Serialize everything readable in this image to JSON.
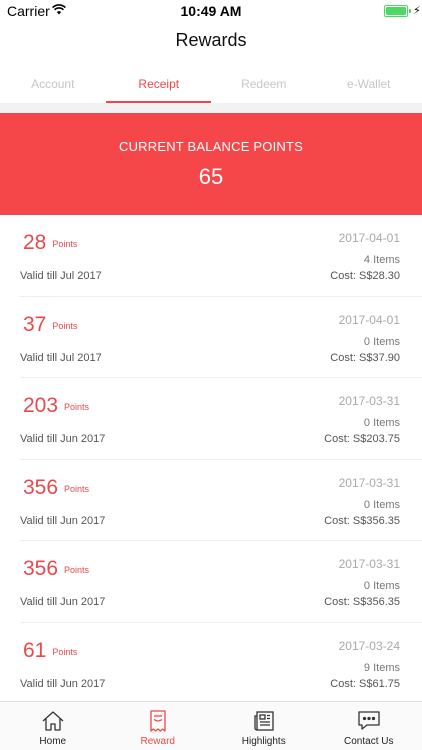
{
  "status_bar": {
    "carrier": "Carrier",
    "time": "10:49 AM",
    "battery_color": "#4cd964"
  },
  "nav": {
    "title": "Rewards"
  },
  "tabs": [
    {
      "label": "Account",
      "active": false
    },
    {
      "label": "Receipt",
      "active": true
    },
    {
      "label": "Redeem",
      "active": false
    },
    {
      "label": "e-Wallet",
      "active": false
    }
  ],
  "balance": {
    "label": "CURRENT BALANCE POINTS",
    "value": "65",
    "background": "#f5474a"
  },
  "points_unit": "Points",
  "receipts": [
    {
      "points": "28",
      "date": "2017-04-01",
      "items": "4 Items",
      "valid": "Valid till Jul 2017",
      "cost": "Cost: S$28.30"
    },
    {
      "points": "37",
      "date": "2017-04-01",
      "items": "0 Items",
      "valid": "Valid till Jul 2017",
      "cost": "Cost: S$37.90"
    },
    {
      "points": "203",
      "date": "2017-03-31",
      "items": "0 Items",
      "valid": "Valid till Jun 2017",
      "cost": "Cost: S$203.75"
    },
    {
      "points": "356",
      "date": "2017-03-31",
      "items": "0 Items",
      "valid": "Valid till Jun 2017",
      "cost": "Cost: S$356.35"
    },
    {
      "points": "356",
      "date": "2017-03-31",
      "items": "0 Items",
      "valid": "Valid till Jun 2017",
      "cost": "Cost: S$356.35"
    },
    {
      "points": "61",
      "date": "2017-03-24",
      "items": "9 Items",
      "valid": "Valid till Jun 2017",
      "cost": "Cost: S$61.75"
    }
  ],
  "tabbar": [
    {
      "label": "Home",
      "icon": "home-icon",
      "active": false
    },
    {
      "label": "Reward",
      "icon": "receipt-icon",
      "active": true
    },
    {
      "label": "Highlights",
      "icon": "newspaper-icon",
      "active": false
    },
    {
      "label": "Contact Us",
      "icon": "chat-icon",
      "active": false
    }
  ],
  "accent_color": "#e9494c"
}
